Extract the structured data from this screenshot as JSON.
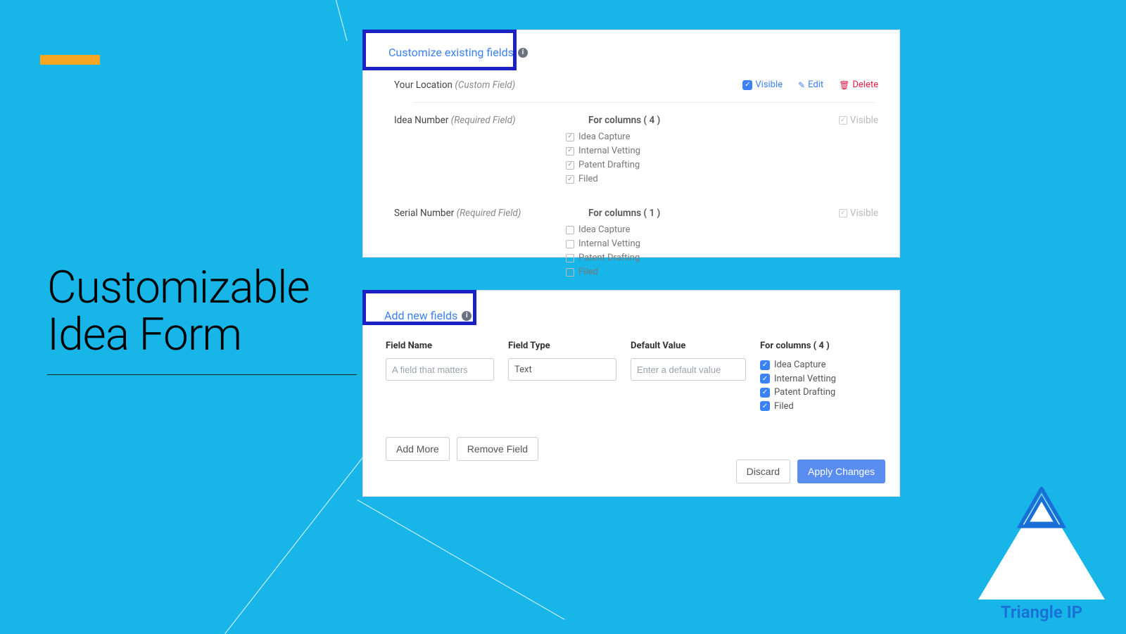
{
  "headline": {
    "line1": "Customizable",
    "line2": "Idea Form"
  },
  "top_panel": {
    "title": "Customize existing fields",
    "rows": [
      {
        "name": "Your Location",
        "paren": "(Custom Field)",
        "actions": {
          "visible": "Visible",
          "edit": "Edit",
          "delete": "Delete"
        }
      },
      {
        "name": "Idea Number",
        "paren": "(Required Field)",
        "for_cols_label": "For columns ( 4 )",
        "cols": [
          {
            "label": "Idea Capture",
            "checked": true
          },
          {
            "label": "Internal Vetting",
            "checked": true
          },
          {
            "label": "Patent Drafting",
            "checked": true
          },
          {
            "label": "Filed",
            "checked": true
          }
        ],
        "ghost_visible": "Visible"
      },
      {
        "name": "Serial Number",
        "paren": "(Required Field)",
        "for_cols_label": "For columns ( 1 )",
        "cols": [
          {
            "label": "Idea Capture",
            "checked": false
          },
          {
            "label": "Internal Vetting",
            "checked": false
          },
          {
            "label": "Patent Drafting",
            "checked": false
          },
          {
            "label": "Filed",
            "checked": true
          }
        ],
        "ghost_visible": "Visible"
      }
    ]
  },
  "bottom_panel": {
    "title": "Add new fields",
    "headers": {
      "field_name": "Field Name",
      "field_type": "Field Type",
      "default_value": "Default Value",
      "for_columns": "For columns ( 4 )"
    },
    "placeholders": {
      "field_name": "A field that matters",
      "default_value": "Enter a default value"
    },
    "field_type_value": "Text",
    "cols": [
      {
        "label": "Idea Capture"
      },
      {
        "label": "Internal Vetting"
      },
      {
        "label": "Patent Drafting"
      },
      {
        "label": "Filed"
      }
    ],
    "buttons": {
      "add_more": "Add More",
      "remove_field": "Remove Field",
      "discard": "Discard",
      "apply": "Apply Changes"
    }
  },
  "logo": {
    "text": "Triangle IP"
  }
}
